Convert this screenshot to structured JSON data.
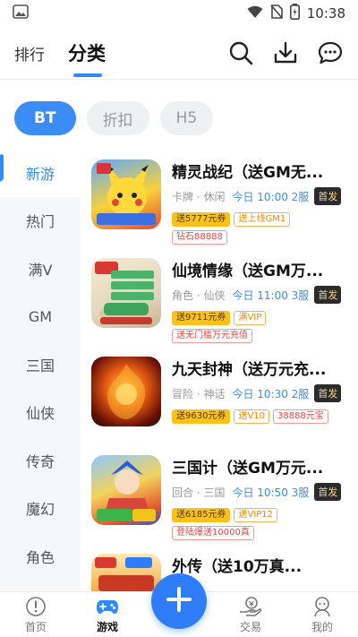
{
  "status_bar": {
    "time": "10:38"
  },
  "header": {
    "tabs": [
      {
        "label": "排行"
      },
      {
        "label": "分类"
      }
    ],
    "icons": [
      "search-icon",
      "download-icon",
      "message-icon"
    ]
  },
  "filters": [
    {
      "label": "BT",
      "active": true
    },
    {
      "label": "折扣",
      "active": false
    },
    {
      "label": "H5",
      "active": false
    }
  ],
  "sidebar": {
    "items": [
      {
        "label": "新游",
        "active": true
      },
      {
        "label": "热门"
      },
      {
        "label": "满V"
      },
      {
        "label": "GM"
      },
      {
        "label": "三国"
      },
      {
        "label": "仙侠"
      },
      {
        "label": "传奇"
      },
      {
        "label": "魔幻"
      },
      {
        "label": "角色"
      }
    ]
  },
  "games": [
    {
      "title": "精灵战纪（送GM无...",
      "genre": "卡牌 · 休闲",
      "server": "今日 10:00 2服",
      "badge": "首发",
      "tags": [
        {
          "text": "送5777元券",
          "style": "coupon"
        },
        {
          "text": "送上线GM1",
          "style": "orange"
        },
        {
          "text": "钻石88888",
          "style": "red"
        }
      ]
    },
    {
      "title": "仙境情缘（送GM万...",
      "genre": "角色 · 仙侠",
      "server": "今日 11:00 3服",
      "badge": "首发",
      "tags": [
        {
          "text": "送9711元券",
          "style": "coupon"
        },
        {
          "text": "满VIP",
          "style": "orange"
        },
        {
          "text": "送无门槛万元充值",
          "style": "red"
        }
      ]
    },
    {
      "title": "九天封神（送万元充...",
      "genre": "冒险 · 神话",
      "server": "今日 10:30 2服",
      "badge": "首发",
      "tags": [
        {
          "text": "送9630元券",
          "style": "coupon"
        },
        {
          "text": "送V10",
          "style": "orange"
        },
        {
          "text": "38888元宝",
          "style": "red"
        }
      ]
    },
    {
      "title": "三国计（送GM万元...",
      "genre": "回合 · 三国",
      "server": "今日 10:50 3服",
      "badge": "首发",
      "tags": [
        {
          "text": "送6185元券",
          "style": "coupon"
        },
        {
          "text": "送VIP12",
          "style": "orange"
        },
        {
          "text": "登陆爆送10000真",
          "style": "red"
        }
      ]
    },
    {
      "title": "外传（送10万真...",
      "genre": "",
      "server": "",
      "badge": "",
      "tags": []
    }
  ],
  "bottom_nav": [
    {
      "label": "首页",
      "icon": "home-icon"
    },
    {
      "label": "游戏",
      "icon": "gamepad-icon",
      "active": true
    },
    {
      "label": "交易",
      "icon": "trade-icon"
    },
    {
      "label": "我的",
      "icon": "profile-icon"
    }
  ],
  "colors": {
    "accent": "#2f8bff",
    "coupon": "#f9c21a"
  }
}
